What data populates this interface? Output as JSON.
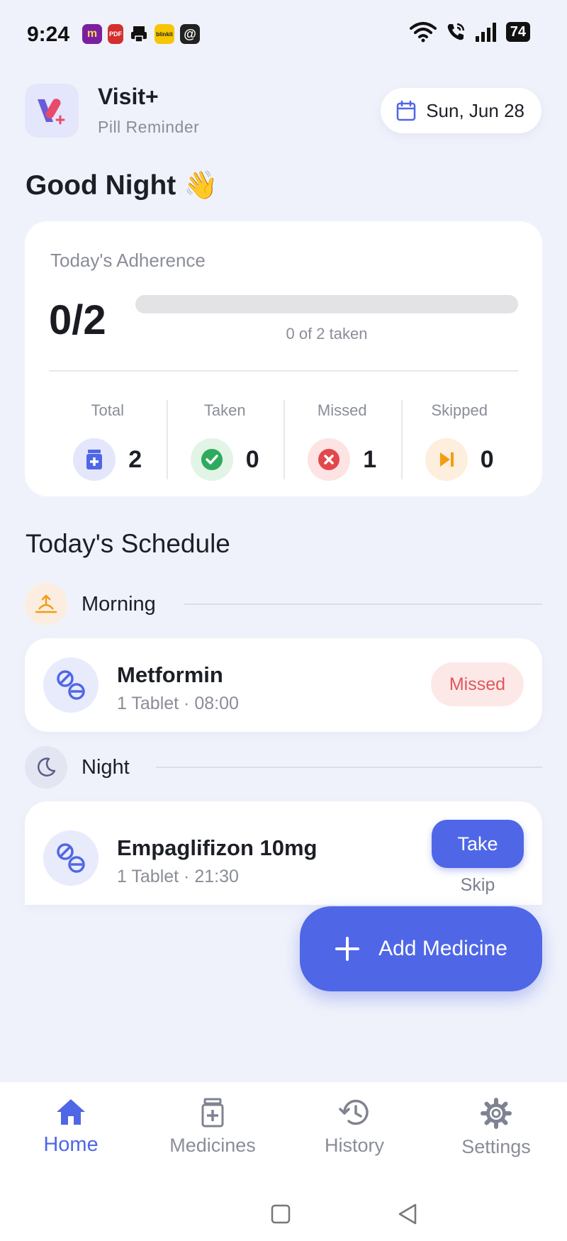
{
  "status_bar": {
    "time": "9:24",
    "notification_icons": [
      {
        "name": "magicpin-app-icon",
        "text": "m",
        "color": "#7b1fa2"
      },
      {
        "name": "pdf-app-icon",
        "text": "PDF",
        "color": "#d32f2f"
      },
      {
        "name": "printer-app-icon",
        "text": "",
        "color": "#222222"
      },
      {
        "name": "blinkit-app-icon",
        "text": "blinkit",
        "color": "#f7c600"
      },
      {
        "name": "threads-app-icon",
        "text": "@",
        "color": "#222222"
      }
    ],
    "battery": "74"
  },
  "header": {
    "app_title": "Visit+",
    "app_subtitle": "Pill Reminder",
    "date": "Sun, Jun 28"
  },
  "greeting": "Good Night 👋",
  "adherence": {
    "label": "Today's Adherence",
    "count": "0/2",
    "progress_fraction": 0,
    "progress_text": "0 of 2 taken",
    "stats": [
      {
        "label": "Total",
        "value": "2",
        "icon": "medicine-bottle-icon",
        "bg": "#e4e7fb",
        "color": "#4f67e6"
      },
      {
        "label": "Taken",
        "value": "0",
        "icon": "check-icon",
        "bg": "#e2f4e6",
        "color": "#2eaa5c"
      },
      {
        "label": "Missed",
        "value": "1",
        "icon": "x-icon",
        "bg": "#fde3e3",
        "color": "#e2474b"
      },
      {
        "label": "Skipped",
        "value": "0",
        "icon": "skip-icon",
        "bg": "#fdeedd",
        "color": "#f39c12"
      }
    ]
  },
  "schedule": {
    "title": "Today's Schedule",
    "morning": {
      "label": "Morning",
      "medicine": {
        "name": "Metformin",
        "detail": "1 Tablet · 08:00",
        "status": "Missed"
      }
    },
    "night": {
      "label": "Night",
      "medicine": {
        "name": "Empaglifizon 10mg",
        "detail": "1 Tablet · 21:30",
        "take_label": "Take",
        "skip_label": "Skip"
      }
    }
  },
  "fab": {
    "label": "Add Medicine"
  },
  "nav": {
    "items": [
      {
        "label": "Home",
        "icon": "home-icon",
        "active": true
      },
      {
        "label": "Medicines",
        "icon": "medicine-bottle-icon",
        "active": false
      },
      {
        "label": "History",
        "icon": "history-icon",
        "active": false
      },
      {
        "label": "Settings",
        "icon": "gear-icon",
        "active": false
      }
    ]
  },
  "colors": {
    "accent": "#4f67e6",
    "background": "#f0f2fb",
    "missed": "#e0575b"
  }
}
